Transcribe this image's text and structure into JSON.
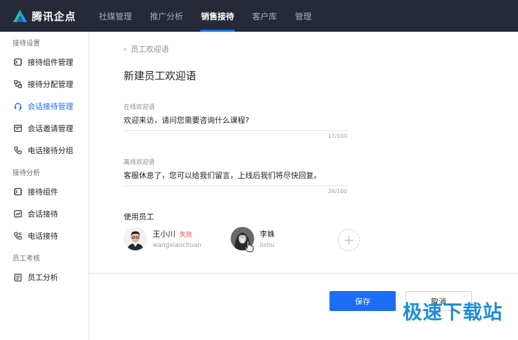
{
  "brand": {
    "name": "腾讯企点",
    "logo_icon": "tencent-qidian-logo"
  },
  "nav": [
    {
      "label": "社媒管理",
      "active": false
    },
    {
      "label": "推广分析",
      "active": false
    },
    {
      "label": "销售接待",
      "active": true
    },
    {
      "label": "客户库",
      "active": false
    },
    {
      "label": "管理",
      "active": false
    }
  ],
  "sidebar": {
    "groups": [
      {
        "title": "接待设置",
        "items": [
          {
            "label": "接待组件管理",
            "icon": "widget-icon"
          },
          {
            "label": "接待分配管理",
            "icon": "assign-icon"
          },
          {
            "label": "会话接待管理",
            "icon": "headset-icon",
            "active": true
          },
          {
            "label": "会话邀请管理",
            "icon": "invite-icon"
          },
          {
            "label": "电话接待分组",
            "icon": "phone-icon"
          }
        ]
      },
      {
        "title": "接待分析",
        "items": [
          {
            "label": "接待组件",
            "icon": "component-icon"
          },
          {
            "label": "会话接待",
            "icon": "chat-chart-icon"
          },
          {
            "label": "电话接待",
            "icon": "phone-call-icon"
          }
        ]
      },
      {
        "title": "员工考核",
        "items": [
          {
            "label": "员工分析",
            "icon": "clipboard-icon"
          }
        ]
      }
    ]
  },
  "main": {
    "breadcrumb": "员工欢迎语",
    "title": "新建员工欢迎语",
    "online": {
      "label": "在线欢迎语",
      "value": "欢迎来访，请问您需要咨询什么课程?",
      "count": "17/100"
    },
    "offline": {
      "label": "离线欢迎语",
      "value": "客服休息了，您可以给我们留言，上线后我们将尽快回复。",
      "count": "26/100"
    },
    "staff_title": "使用员工",
    "staff": [
      {
        "name": "王小川",
        "status": "失效",
        "account": "wangxiaochuan"
      },
      {
        "name": "李姝",
        "status": "",
        "account": "lishu"
      }
    ],
    "add_label": "+",
    "save_label": "保存",
    "cancel_label": "取消"
  },
  "watermark": "极速下载站",
  "colors": {
    "accent": "#1b6ef3",
    "topbar": "#252a36",
    "invalid": "#e5483b",
    "watermark": "#1e8fd6"
  }
}
